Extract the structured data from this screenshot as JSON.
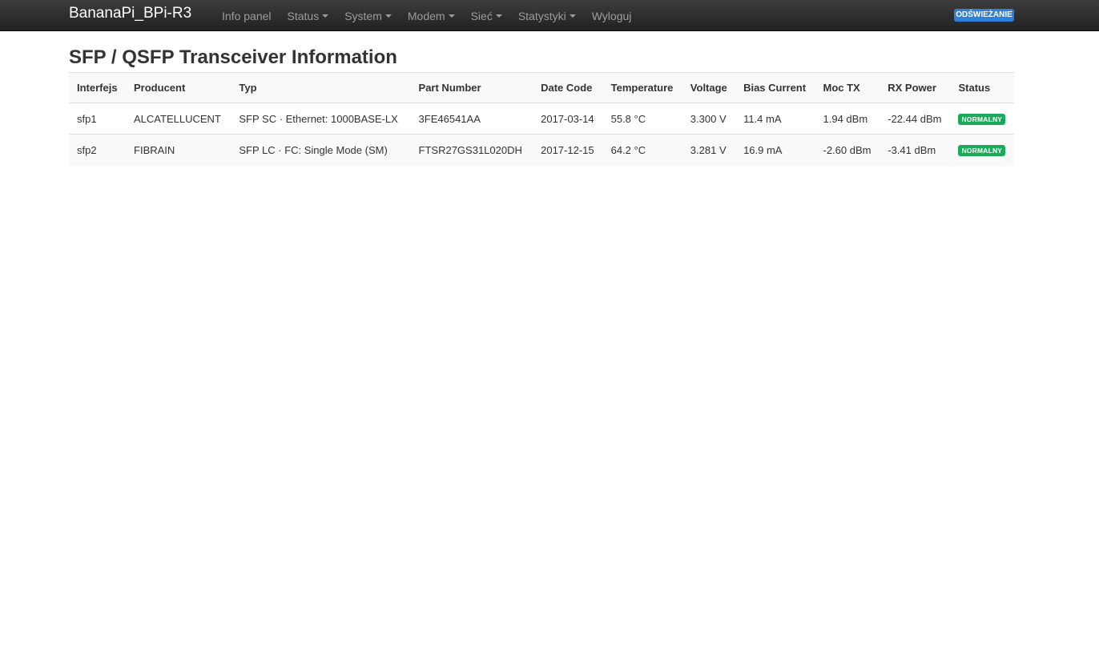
{
  "navbar": {
    "brand": "BananaPi_BPi-R3",
    "items": [
      {
        "label": "Info panel",
        "dropdown": false
      },
      {
        "label": "Status",
        "dropdown": true
      },
      {
        "label": "System",
        "dropdown": true
      },
      {
        "label": "Modem",
        "dropdown": true
      },
      {
        "label": "Sieć",
        "dropdown": true
      },
      {
        "label": "Statystyki",
        "dropdown": true
      },
      {
        "label": "Wyloguj",
        "dropdown": false
      }
    ],
    "refresh_label": "ODŚWIEŻANIE"
  },
  "page": {
    "title": "SFP / QSFP Transceiver Information"
  },
  "table": {
    "headers": [
      "Interfejs",
      "Producent",
      "Typ",
      "Part Number",
      "Date Code",
      "Temperature",
      "Voltage",
      "Bias Current",
      "Moc TX",
      "RX Power",
      "Status"
    ],
    "rows": [
      {
        "interface": "sfp1",
        "vendor": "ALCATELLUCENT",
        "type": "SFP SC · Ethernet: 1000BASE-LX",
        "part_number": "3FE46541AA",
        "date_code": "2017-03-14",
        "temperature": "55.8 °C",
        "voltage": "3.300 V",
        "bias_current": "11.4 mA",
        "tx_power": "1.94 dBm",
        "rx_power": "-22.44 dBm",
        "status": "NORMALNY"
      },
      {
        "interface": "sfp2",
        "vendor": "FIBRAIN",
        "type": "SFP LC · FC: Single Mode (SM)",
        "part_number": "FTSR27GS31L020DH",
        "date_code": "2017-12-15",
        "temperature": "64.2 °C",
        "voltage": "3.281 V",
        "bias_current": "16.9 mA",
        "tx_power": "-2.60 dBm",
        "rx_power": "-3.41 dBm",
        "status": "NORMALNY"
      }
    ]
  },
  "colors": {
    "navbar_bg": "#222222",
    "refresh_button": "#2f80d8",
    "status_ok": "#1aab5a"
  }
}
